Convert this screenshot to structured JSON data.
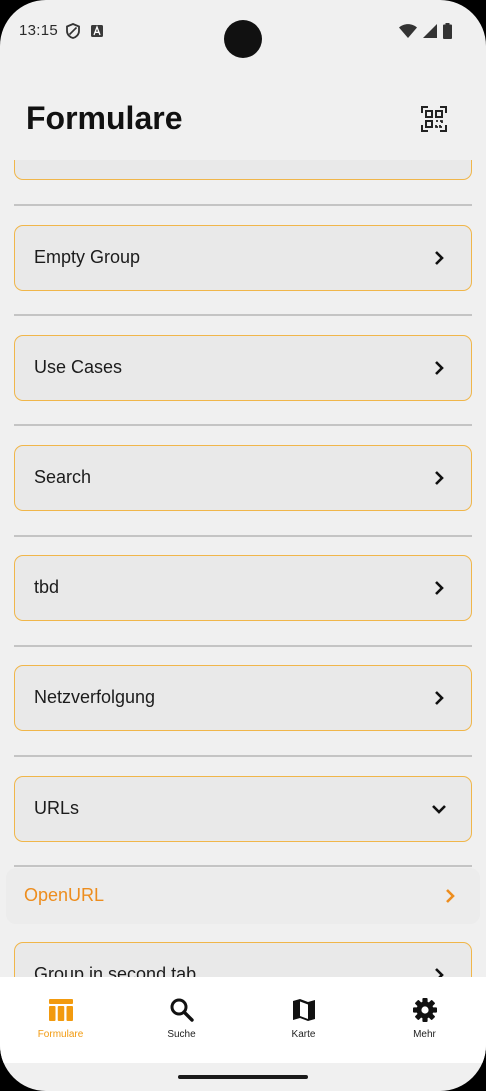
{
  "status_bar": {
    "time": "13:15",
    "left_icons": [
      "shield-icon",
      "keyboard-a-icon"
    ],
    "right_icons": [
      "wifi-icon",
      "signal-icon",
      "battery-icon"
    ]
  },
  "header": {
    "title": "Formulare",
    "qr_icon": "qr-code-icon"
  },
  "list": {
    "items": [
      {
        "label": "Empty Group",
        "type": "group",
        "expanded": false
      },
      {
        "label": "Use Cases",
        "type": "group",
        "expanded": false
      },
      {
        "label": "Search",
        "type": "group",
        "expanded": false
      },
      {
        "label": "tbd",
        "type": "group",
        "expanded": false
      },
      {
        "label": "Netzverfolgung",
        "type": "group",
        "expanded": false
      },
      {
        "label": "URLs",
        "type": "group",
        "expanded": true
      },
      {
        "label": "OpenURL",
        "type": "link"
      },
      {
        "label": "Group in second tab",
        "type": "group",
        "expanded": false
      }
    ]
  },
  "bottom_nav": {
    "items": [
      {
        "label": "Formulare",
        "icon": "forms-icon",
        "active": true
      },
      {
        "label": "Suche",
        "icon": "search-icon",
        "active": false
      },
      {
        "label": "Karte",
        "icon": "map-icon",
        "active": false
      },
      {
        "label": "Mehr",
        "icon": "gear-icon",
        "active": false
      }
    ]
  },
  "colors": {
    "accent": "#f29a0e",
    "card_border": "#f0b64a",
    "link_text": "#ed8d1e",
    "background": "#f0f0f0"
  }
}
